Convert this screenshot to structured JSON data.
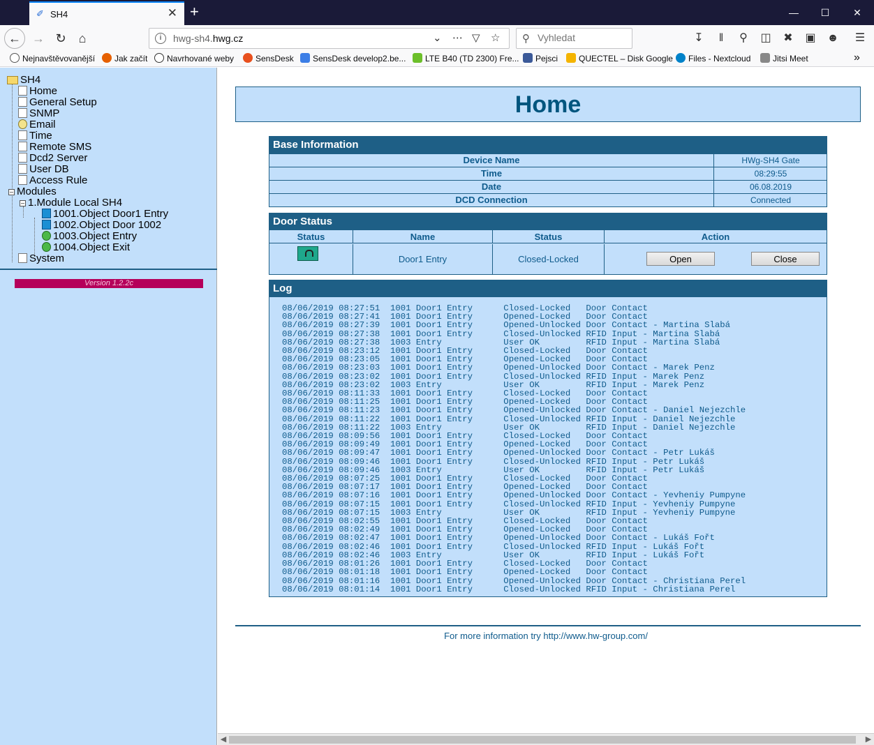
{
  "browser": {
    "tab_title": "SH4",
    "tab_close": "✕",
    "new_tab": "+",
    "url_prefix": "hwg-sh4.",
    "url_domain": "hwg.cz",
    "search_placeholder": "Vyhledat",
    "bookmarks": [
      "Nejnavštěvovanější",
      "Jak začít",
      "Navrhované weby",
      "SensDesk",
      "SensDesk develop2.be...",
      "LTE B40 (TD 2300) Fre...",
      "Pejsci",
      "QUECTEL – Disk Google",
      "Files - Nextcloud",
      "Jitsi Meet"
    ]
  },
  "sidebar": {
    "root": "SH4",
    "items": [
      "Home",
      "General Setup",
      "SNMP",
      "Email",
      "Time",
      "Remote SMS",
      "Dcd2 Server",
      "User DB",
      "Access Rule"
    ],
    "modules_label": "Modules",
    "module": "1.Module Local SH4",
    "objects": [
      "1001.Object Door1 Entry",
      "1002.Object Door 1002",
      "1003.Object Entry",
      "1004.Object Exit"
    ],
    "system": "System",
    "version": "Version 1.2.2c"
  },
  "page": {
    "title": "Home",
    "base_info": {
      "header": "Base Information",
      "rows": [
        {
          "key": "Device Name",
          "value": "HWg-SH4 Gate"
        },
        {
          "key": "Time",
          "value": "08:29:55"
        },
        {
          "key": "Date",
          "value": "06.08.2019"
        },
        {
          "key": "DCD Connection",
          "value": "Connected"
        }
      ]
    },
    "door_status": {
      "header": "Door Status",
      "col_status": "Status",
      "col_name": "Name",
      "col_status2": "Status",
      "col_action": "Action",
      "name": "Door1 Entry",
      "state": "Closed-Locked",
      "open_label": "Open",
      "close_label": "Close"
    },
    "log": {
      "header": "Log",
      "lines": [
        "08/06/2019 08:27:51  1001 Door1 Entry      Closed-Locked   Door Contact",
        "08/06/2019 08:27:41  1001 Door1 Entry      Opened-Locked   Door Contact",
        "08/06/2019 08:27:39  1001 Door1 Entry      Opened-Unlocked Door Contact - Martina Slabá",
        "08/06/2019 08:27:38  1001 Door1 Entry      Closed-Unlocked RFID Input - Martina Slabá",
        "08/06/2019 08:27:38  1003 Entry            User OK         RFID Input - Martina Slabá",
        "08/06/2019 08:23:12  1001 Door1 Entry      Closed-Locked   Door Contact",
        "08/06/2019 08:23:05  1001 Door1 Entry      Opened-Locked   Door Contact",
        "08/06/2019 08:23:03  1001 Door1 Entry      Opened-Unlocked Door Contact - Marek Penz",
        "08/06/2019 08:23:02  1001 Door1 Entry      Closed-Unlocked RFID Input - Marek Penz",
        "08/06/2019 08:23:02  1003 Entry            User OK         RFID Input - Marek Penz",
        "08/06/2019 08:11:33  1001 Door1 Entry      Closed-Locked   Door Contact",
        "08/06/2019 08:11:25  1001 Door1 Entry      Opened-Locked   Door Contact",
        "08/06/2019 08:11:23  1001 Door1 Entry      Opened-Unlocked Door Contact - Daniel Nejezchle",
        "08/06/2019 08:11:22  1001 Door1 Entry      Closed-Unlocked RFID Input - Daniel Nejezchle",
        "08/06/2019 08:11:22  1003 Entry            User OK         RFID Input - Daniel Nejezchle",
        "08/06/2019 08:09:56  1001 Door1 Entry      Closed-Locked   Door Contact",
        "08/06/2019 08:09:49  1001 Door1 Entry      Opened-Locked   Door Contact",
        "08/06/2019 08:09:47  1001 Door1 Entry      Opened-Unlocked Door Contact - Petr Lukáš",
        "08/06/2019 08:09:46  1001 Door1 Entry      Closed-Unlocked RFID Input - Petr Lukáš",
        "08/06/2019 08:09:46  1003 Entry            User OK         RFID Input - Petr Lukáš",
        "08/06/2019 08:07:25  1001 Door1 Entry      Closed-Locked   Door Contact",
        "08/06/2019 08:07:17  1001 Door1 Entry      Opened-Locked   Door Contact",
        "08/06/2019 08:07:16  1001 Door1 Entry      Opened-Unlocked Door Contact - Yevheniy Pumpyne",
        "08/06/2019 08:07:15  1001 Door1 Entry      Closed-Unlocked RFID Input - Yevheniy Pumpyne",
        "08/06/2019 08:07:15  1003 Entry            User OK         RFID Input - Yevheniy Pumpyne",
        "08/06/2019 08:02:55  1001 Door1 Entry      Closed-Locked   Door Contact",
        "08/06/2019 08:02:49  1001 Door1 Entry      Opened-Locked   Door Contact",
        "08/06/2019 08:02:47  1001 Door1 Entry      Opened-Unlocked Door Contact - Lukáš Fořt",
        "08/06/2019 08:02:46  1001 Door1 Entry      Closed-Unlocked RFID Input - Lukáš Fořt",
        "08/06/2019 08:02:46  1003 Entry            User OK         RFID Input - Lukáš Fořt",
        "08/06/2019 08:01:26  1001 Door1 Entry      Closed-Locked   Door Contact",
        "08/06/2019 08:01:18  1001 Door1 Entry      Opened-Locked   Door Contact",
        "08/06/2019 08:01:16  1001 Door1 Entry      Opened-Unlocked Door Contact - Christiana Perel",
        "08/06/2019 08:01:14  1001 Door1 Entry      Closed-Unlocked RFID Input - Christiana Perel"
      ]
    },
    "footer": "For more information try http://www.hw-group.com/"
  }
}
